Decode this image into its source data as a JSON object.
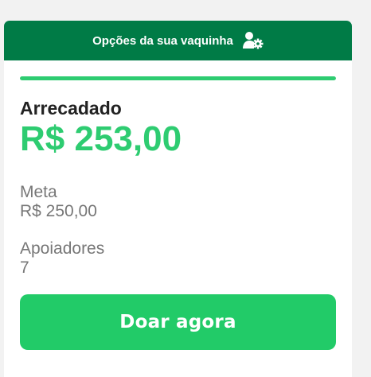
{
  "header": {
    "label": "Opções da sua vaquinha",
    "icon": "user-settings-icon"
  },
  "progress": {
    "fraction": 1.0,
    "color": "#2ecc71"
  },
  "raised": {
    "label": "Arrecadado",
    "amount": "R$ 253,00"
  },
  "goal": {
    "label": "Meta",
    "value": "R$ 250,00"
  },
  "supporters": {
    "label": "Apoiadores",
    "value": "7"
  },
  "donate_button": {
    "label": "Doar agora"
  },
  "colors": {
    "header_bg": "#007b46",
    "accent": "#2ecc71",
    "button": "#22cb68"
  }
}
